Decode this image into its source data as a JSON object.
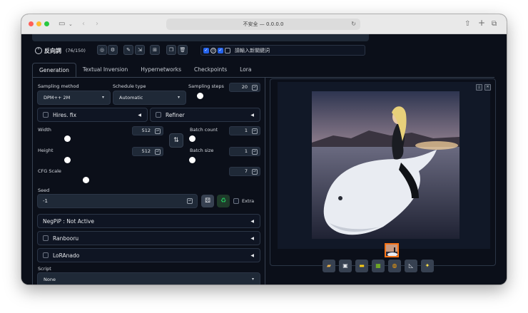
{
  "browser": {
    "url_text": "不安全 — 0.0.0.0",
    "reload_icon": "reload-icon"
  },
  "negative_prompt": {
    "title": "反向詞",
    "count": "(76/150)",
    "keyword_placeholder": "請輸入新關鍵詞"
  },
  "tabs": [
    "Generation",
    "Textual Inversion",
    "Hypernetworks",
    "Checkpoints",
    "Lora"
  ],
  "generation": {
    "sampling_method_label": "Sampling method",
    "sampling_method_value": "DPM++ 2M",
    "schedule_type_label": "Schedule type",
    "schedule_type_value": "Automatic",
    "sampling_steps_label": "Sampling steps",
    "sampling_steps_value": "20",
    "hires_fix_label": "Hires. fix",
    "refiner_label": "Refiner",
    "width_label": "Width",
    "width_value": "512",
    "height_label": "Height",
    "height_value": "512",
    "batch_count_label": "Batch count",
    "batch_count_value": "1",
    "batch_size_label": "Batch size",
    "batch_size_value": "1",
    "cfg_scale_label": "CFG Scale",
    "cfg_scale_value": "7",
    "seed_label": "Seed",
    "seed_value": "-1",
    "extra_label": "Extra",
    "negpip_label": "NegPiP : Not Active",
    "ranbooru_label": "Ranbooru",
    "loranado_label": "LoRAnado",
    "script_label": "Script",
    "script_value": "None"
  },
  "colors": {
    "background": "#0b0f19",
    "panel": "#1f2937",
    "accent_blue": "#2563eb",
    "thumb_border": "#f97316",
    "seed_recycle_green": "#16a34a"
  },
  "output_tools": [
    "folder-icon",
    "save-icon",
    "zip-icon",
    "image-icon",
    "palette-icon",
    "ruler-icon",
    "sparkle-icon"
  ]
}
